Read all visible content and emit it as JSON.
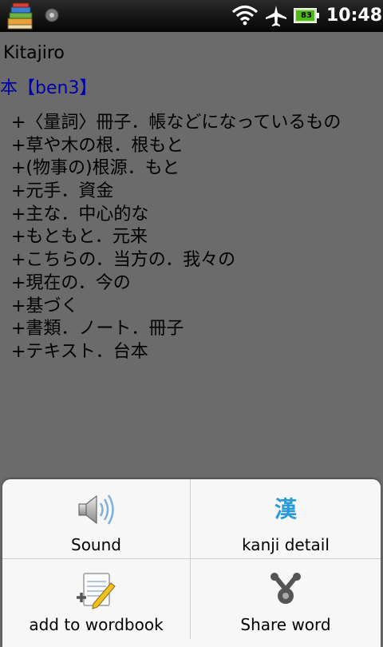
{
  "status_bar": {
    "battery_level": "83",
    "time": "10:48",
    "icons": [
      "books-app-icon",
      "sync-icon",
      "wifi-icon",
      "airplane-icon",
      "battery-icon"
    ]
  },
  "app": {
    "title": "Kitajiro"
  },
  "entry": {
    "heading": "本【ben3】",
    "meanings": [
      "+〈量詞〉冊子．帳などになっているもの",
      "+草や木の根．根もと",
      "+(物事の)根源．もと",
      "+元手．資金",
      "+主な．中心的な",
      "+もともと．元来",
      "+こちらの．当方の．我々の",
      "+現在の．今の",
      "+基づく",
      "+書類．ノート．冊子",
      "+テキスト．台本"
    ]
  },
  "menu": {
    "sound": {
      "label": "Sound",
      "icon": "speaker-icon"
    },
    "kanji_detail": {
      "label": "kanji detail",
      "icon_glyph": "漢"
    },
    "add_to_wordbook": {
      "label": "add to wordbook",
      "icon": "notepad-add-icon"
    },
    "share_word": {
      "label": "Share word",
      "icon": "share-icon"
    }
  },
  "colors": {
    "background": "#6b6b6b",
    "heading": "#0000a8",
    "kanji_icon": "#2a9ad6"
  }
}
